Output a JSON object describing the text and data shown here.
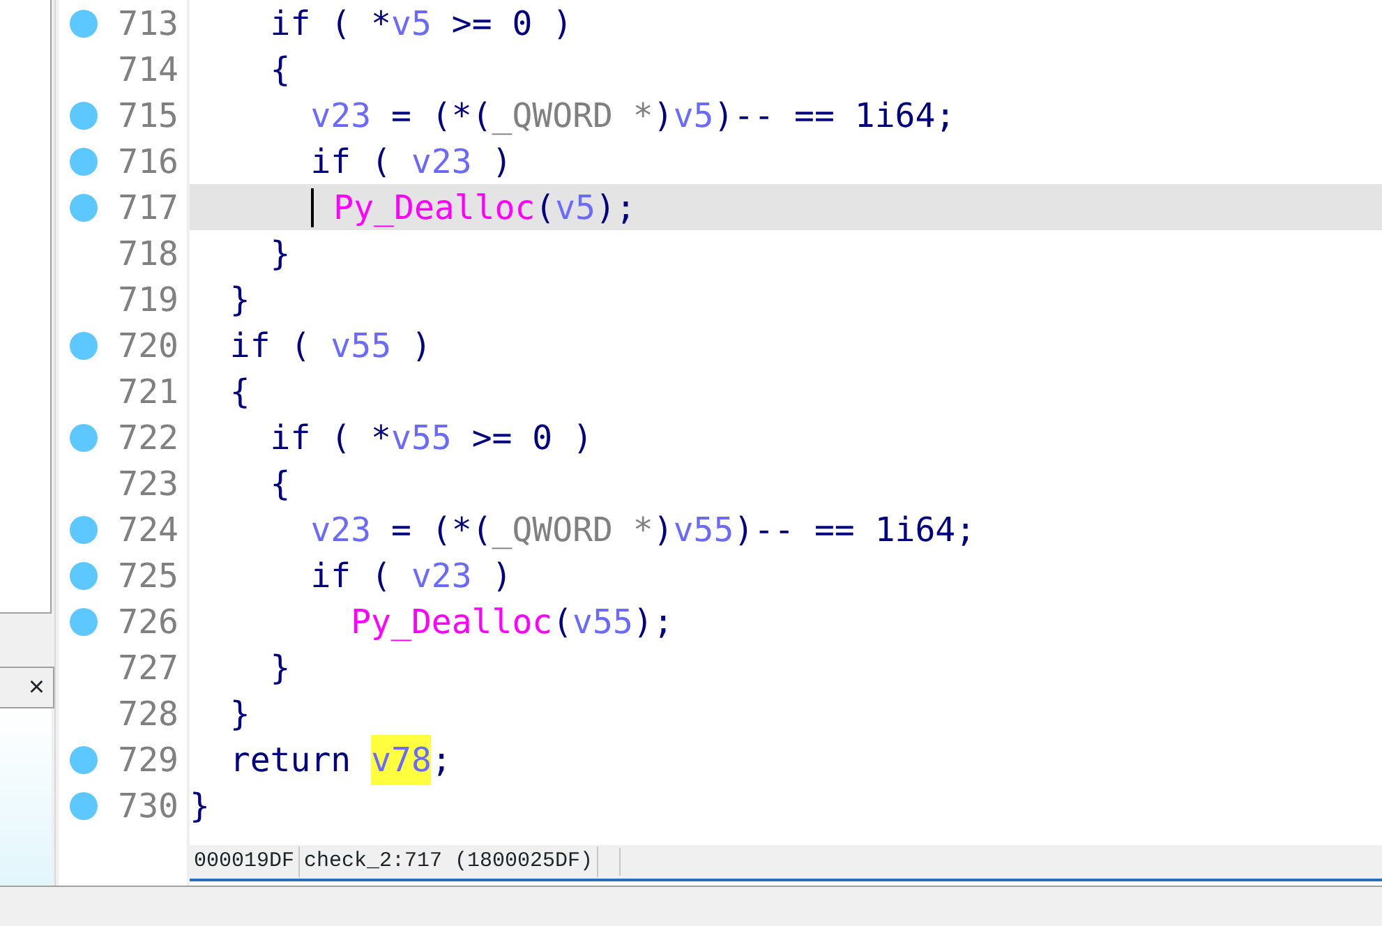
{
  "left_panel": {
    "close_glyph": "×"
  },
  "lines": [
    {
      "number": "713",
      "marker": true,
      "selected": false,
      "tokens": [
        {
          "kind": "keyword",
          "text": "    if"
        },
        {
          "kind": "punct",
          "text": " ( *"
        },
        {
          "kind": "variable",
          "text": "v5"
        },
        {
          "kind": "punct",
          "text": " >= 0 )"
        }
      ]
    },
    {
      "number": "714",
      "marker": false,
      "selected": false,
      "tokens": [
        {
          "kind": "punct",
          "text": "    {"
        }
      ]
    },
    {
      "number": "715",
      "marker": true,
      "selected": false,
      "tokens": [
        {
          "kind": "variable",
          "text": "      v23"
        },
        {
          "kind": "punct",
          "text": " = (*("
        },
        {
          "kind": "type",
          "text": "_QWORD *"
        },
        {
          "kind": "punct",
          "text": ")"
        },
        {
          "kind": "variable",
          "text": "v5"
        },
        {
          "kind": "punct",
          "text": ")-- == 1i64;"
        }
      ]
    },
    {
      "number": "716",
      "marker": true,
      "selected": false,
      "tokens": [
        {
          "kind": "keyword",
          "text": "      if"
        },
        {
          "kind": "punct",
          "text": " ( "
        },
        {
          "kind": "variable",
          "text": "v23"
        },
        {
          "kind": "punct",
          "text": " )"
        }
      ]
    },
    {
      "number": "717",
      "marker": true,
      "selected": true,
      "tokens": [
        {
          "kind": "function",
          "text": "        Py_Dealloc"
        },
        {
          "kind": "punct",
          "text": "("
        },
        {
          "kind": "variable",
          "text": "v5"
        },
        {
          "kind": "punct",
          "text": ");"
        }
      ]
    },
    {
      "number": "718",
      "marker": false,
      "selected": false,
      "tokens": [
        {
          "kind": "punct",
          "text": "    }"
        }
      ]
    },
    {
      "number": "719",
      "marker": false,
      "selected": false,
      "tokens": [
        {
          "kind": "punct",
          "text": "  }"
        }
      ]
    },
    {
      "number": "720",
      "marker": true,
      "selected": false,
      "tokens": [
        {
          "kind": "keyword",
          "text": "  if"
        },
        {
          "kind": "punct",
          "text": " ( "
        },
        {
          "kind": "variable",
          "text": "v55"
        },
        {
          "kind": "punct",
          "text": " )"
        }
      ]
    },
    {
      "number": "721",
      "marker": false,
      "selected": false,
      "tokens": [
        {
          "kind": "punct",
          "text": "  {"
        }
      ]
    },
    {
      "number": "722",
      "marker": true,
      "selected": false,
      "tokens": [
        {
          "kind": "keyword",
          "text": "    if"
        },
        {
          "kind": "punct",
          "text": " ( *"
        },
        {
          "kind": "variable",
          "text": "v55"
        },
        {
          "kind": "punct",
          "text": " >= 0 )"
        }
      ]
    },
    {
      "number": "723",
      "marker": false,
      "selected": false,
      "tokens": [
        {
          "kind": "punct",
          "text": "    {"
        }
      ]
    },
    {
      "number": "724",
      "marker": true,
      "selected": false,
      "tokens": [
        {
          "kind": "variable",
          "text": "      v23"
        },
        {
          "kind": "punct",
          "text": " = (*("
        },
        {
          "kind": "type",
          "text": "_QWORD *"
        },
        {
          "kind": "punct",
          "text": ")"
        },
        {
          "kind": "variable",
          "text": "v55"
        },
        {
          "kind": "punct",
          "text": ")-- == 1i64;"
        }
      ]
    },
    {
      "number": "725",
      "marker": true,
      "selected": false,
      "tokens": [
        {
          "kind": "keyword",
          "text": "      if"
        },
        {
          "kind": "punct",
          "text": " ( "
        },
        {
          "kind": "variable",
          "text": "v23"
        },
        {
          "kind": "punct",
          "text": " )"
        }
      ]
    },
    {
      "number": "726",
      "marker": true,
      "selected": false,
      "tokens": [
        {
          "kind": "function",
          "text": "        Py_Dealloc"
        },
        {
          "kind": "punct",
          "text": "("
        },
        {
          "kind": "variable",
          "text": "v55"
        },
        {
          "kind": "punct",
          "text": ");"
        }
      ]
    },
    {
      "number": "727",
      "marker": false,
      "selected": false,
      "tokens": [
        {
          "kind": "punct",
          "text": "    }"
        }
      ]
    },
    {
      "number": "728",
      "marker": false,
      "selected": false,
      "tokens": [
        {
          "kind": "punct",
          "text": "  }"
        }
      ]
    },
    {
      "number": "729",
      "marker": true,
      "selected": false,
      "tokens": [
        {
          "kind": "keyword",
          "text": "  return "
        },
        {
          "kind": "highlighted",
          "text": "v78"
        },
        {
          "kind": "punct",
          "text": ";"
        }
      ]
    },
    {
      "number": "730",
      "marker": true,
      "selected": false,
      "tokens": [
        {
          "kind": "punct",
          "text": "}"
        }
      ]
    }
  ],
  "status_bar": [
    "000019DF",
    "check_2:717 (1800025DF)"
  ]
}
